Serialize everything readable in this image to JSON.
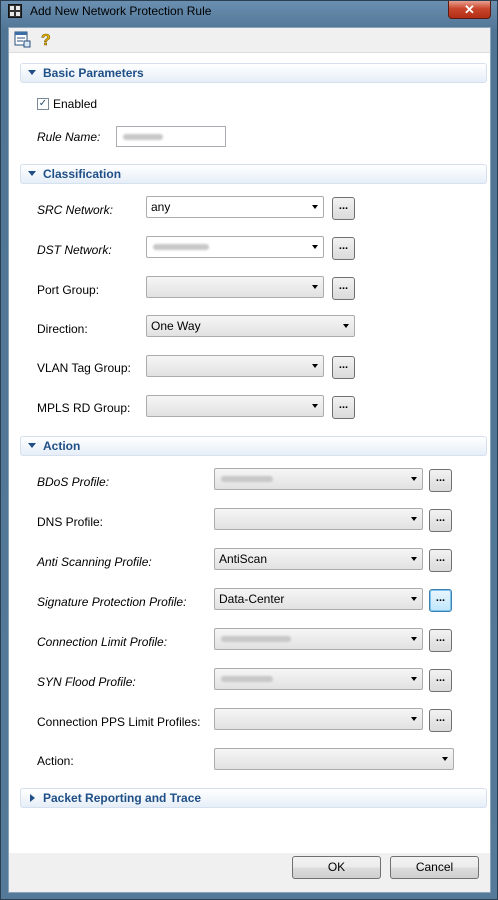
{
  "window": {
    "title": "Add New Network Protection Rule",
    "close_label": "✕"
  },
  "toolbar": {
    "icons": [
      "properties-icon",
      "help-icon"
    ]
  },
  "basic": {
    "header": "Basic Parameters",
    "enabled_label": "Enabled",
    "enabled_checked": true,
    "rule_name_label": "Rule Name:"
  },
  "classification": {
    "header": "Classification",
    "src_label": "SRC Network:",
    "src_value": "any",
    "dst_label": "DST Network:",
    "port_label": "Port Group:",
    "direction_label": "Direction:",
    "direction_value": "One Way",
    "vlan_label": "VLAN Tag Group:",
    "mpls_label": "MPLS RD Group:"
  },
  "action": {
    "header": "Action",
    "bdos_label": "BDoS Profile:",
    "dns_label": "DNS Profile:",
    "anti_label": "Anti Scanning Profile:",
    "anti_value": "AntiScan",
    "sig_label": "Signature Protection Profile:",
    "sig_value": "Data-Center",
    "conn_label": "Connection Limit Profile:",
    "syn_label": "SYN Flood Profile:",
    "pps_label": "Connection PPS Limit Profiles:",
    "action_label": "Action:"
  },
  "packet": {
    "header": "Packet Reporting and Trace"
  },
  "buttons": {
    "ellipsis": "...",
    "ok": "OK",
    "cancel": "Cancel"
  }
}
